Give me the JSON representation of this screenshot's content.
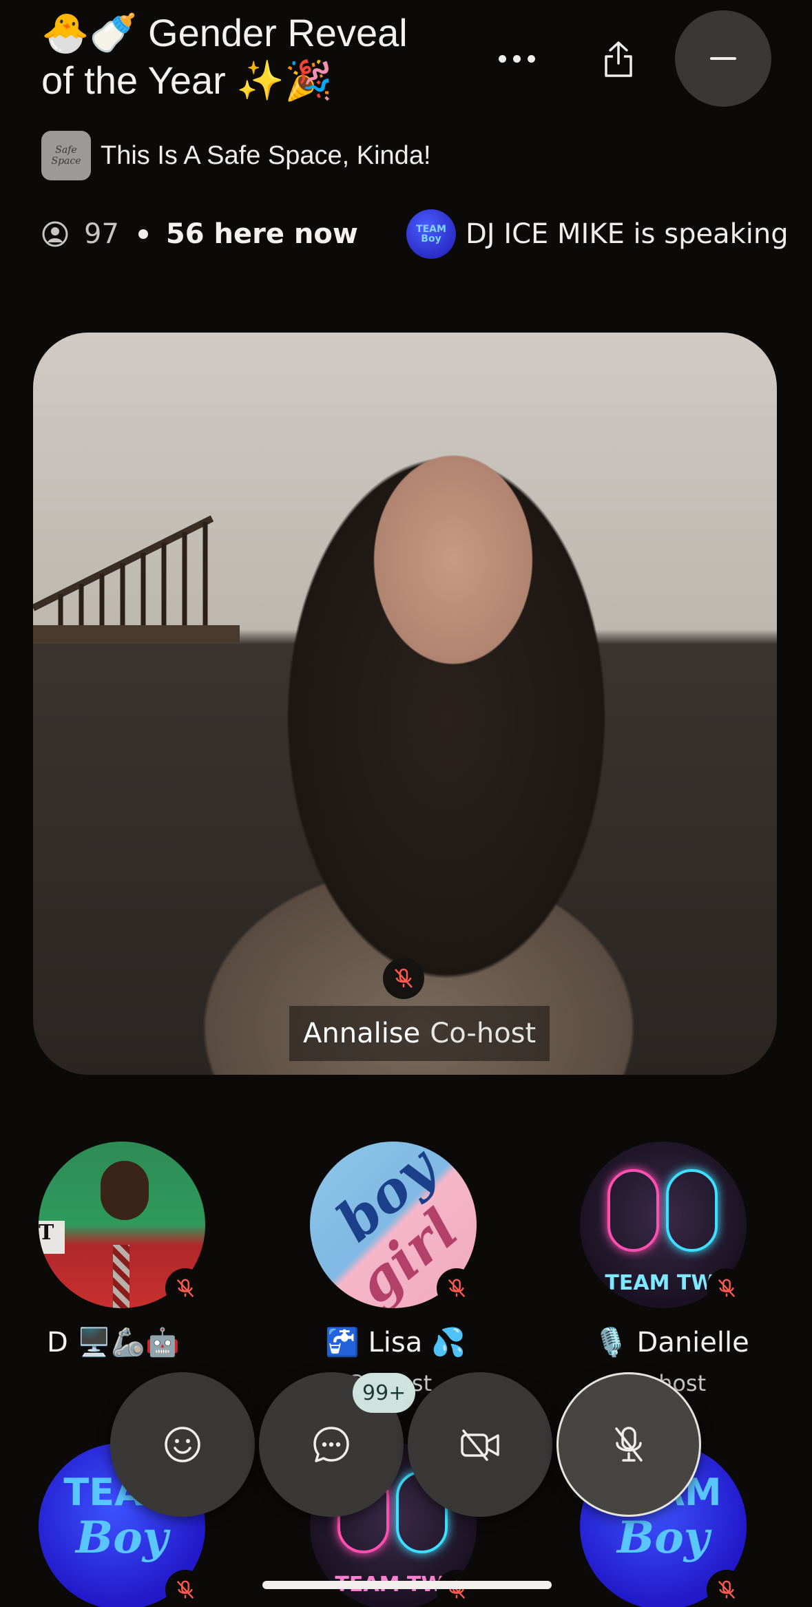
{
  "room": {
    "title_line1": "Gender Reveal",
    "title_emoji1": "🐣🍼",
    "title_line2": "of the Year",
    "title_emoji2": "✨🎉",
    "club_name": "This Is A Safe Space, Kinda!",
    "club_logo_text": "Safe Space",
    "listener_count": "97",
    "here_now": "56 here now",
    "speaking_text": "DJ ICE MIKE is speaking",
    "speaking_avatar_text": "TEAM Boy"
  },
  "video": {
    "name": "Annalise",
    "role": "Co-host"
  },
  "speakers": [
    {
      "name": "D 🖥️🦾🤖",
      "role": ""
    },
    {
      "name": "🚰 Lisa 💦",
      "role": "Co-host",
      "avatar_text_1": "boy",
      "avatar_text_2": "girl"
    },
    {
      "name": "🎙️ Danielle",
      "role": "Co-host",
      "avatar_text": "TEAM TWI"
    },
    {
      "name": "",
      "role": "",
      "avatar_text_1": "TEAM",
      "avatar_text_2": "Boy"
    },
    {
      "name": "",
      "role": "",
      "avatar_text": "TEAM TWI"
    },
    {
      "name": "",
      "role": "",
      "avatar_text_1": "TEAM",
      "avatar_text_2": "Boy"
    }
  ],
  "controls": {
    "chat_badge": "99+"
  },
  "icons": [
    "more-icon",
    "share-icon",
    "minimize-icon",
    "person-icon",
    "mic-off-icon",
    "emoji-icon",
    "chat-icon",
    "video-off-icon"
  ],
  "colors": {
    "background": "#0b0a09",
    "button": "#3a3836",
    "badge": "#cfe3de",
    "muted": "#ff5a4f"
  }
}
